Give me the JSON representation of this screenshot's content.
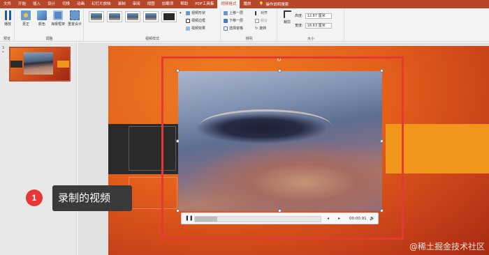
{
  "tabs": [
    {
      "label": "文件"
    },
    {
      "label": "开始"
    },
    {
      "label": "插入"
    },
    {
      "label": "设计"
    },
    {
      "label": "切换"
    },
    {
      "label": "动画"
    },
    {
      "label": "幻灯片放映"
    },
    {
      "label": "录制"
    },
    {
      "label": "审阅"
    },
    {
      "label": "视图"
    },
    {
      "label": "加载项"
    },
    {
      "label": "帮助"
    },
    {
      "label": "PDF工具集"
    },
    {
      "label": "视频格式"
    },
    {
      "label": "播放"
    }
  ],
  "active_tab": "视频格式",
  "tell_me": "操作说明搜索",
  "ribbon": {
    "preview": {
      "play_label": "播放",
      "group_label": "预览"
    },
    "adjust": {
      "correction_label": "更正",
      "color_label": "颜色",
      "poster_label": "海报框架",
      "reset_label": "重置设计",
      "group_label": "调整"
    },
    "styles": {
      "shape_label": "视频形状",
      "border_label": "视频边框",
      "effects_label": "视频效果",
      "group_label": "视频样式"
    },
    "arrange": {
      "forward_label": "上移一层",
      "backward_label": "下移一层",
      "selection_label": "选择窗格",
      "align_label": "对齐",
      "group_label": "组合",
      "rotate_label": "旋转",
      "section_label": "排列"
    },
    "size": {
      "crop_label": "裁剪",
      "height_label": "高度:",
      "height_value": "12.87 厘米",
      "width_label": "宽度:",
      "width_value": "18.63 厘米",
      "group_label": "大小"
    }
  },
  "slides_panel": {
    "number": "1",
    "star": "*"
  },
  "player": {
    "time": "00:00.91",
    "progress": 0.18
  },
  "annotation": {
    "badge": "1",
    "text": "录制的视频"
  },
  "watermark": "@稀土掘金技术社区"
}
